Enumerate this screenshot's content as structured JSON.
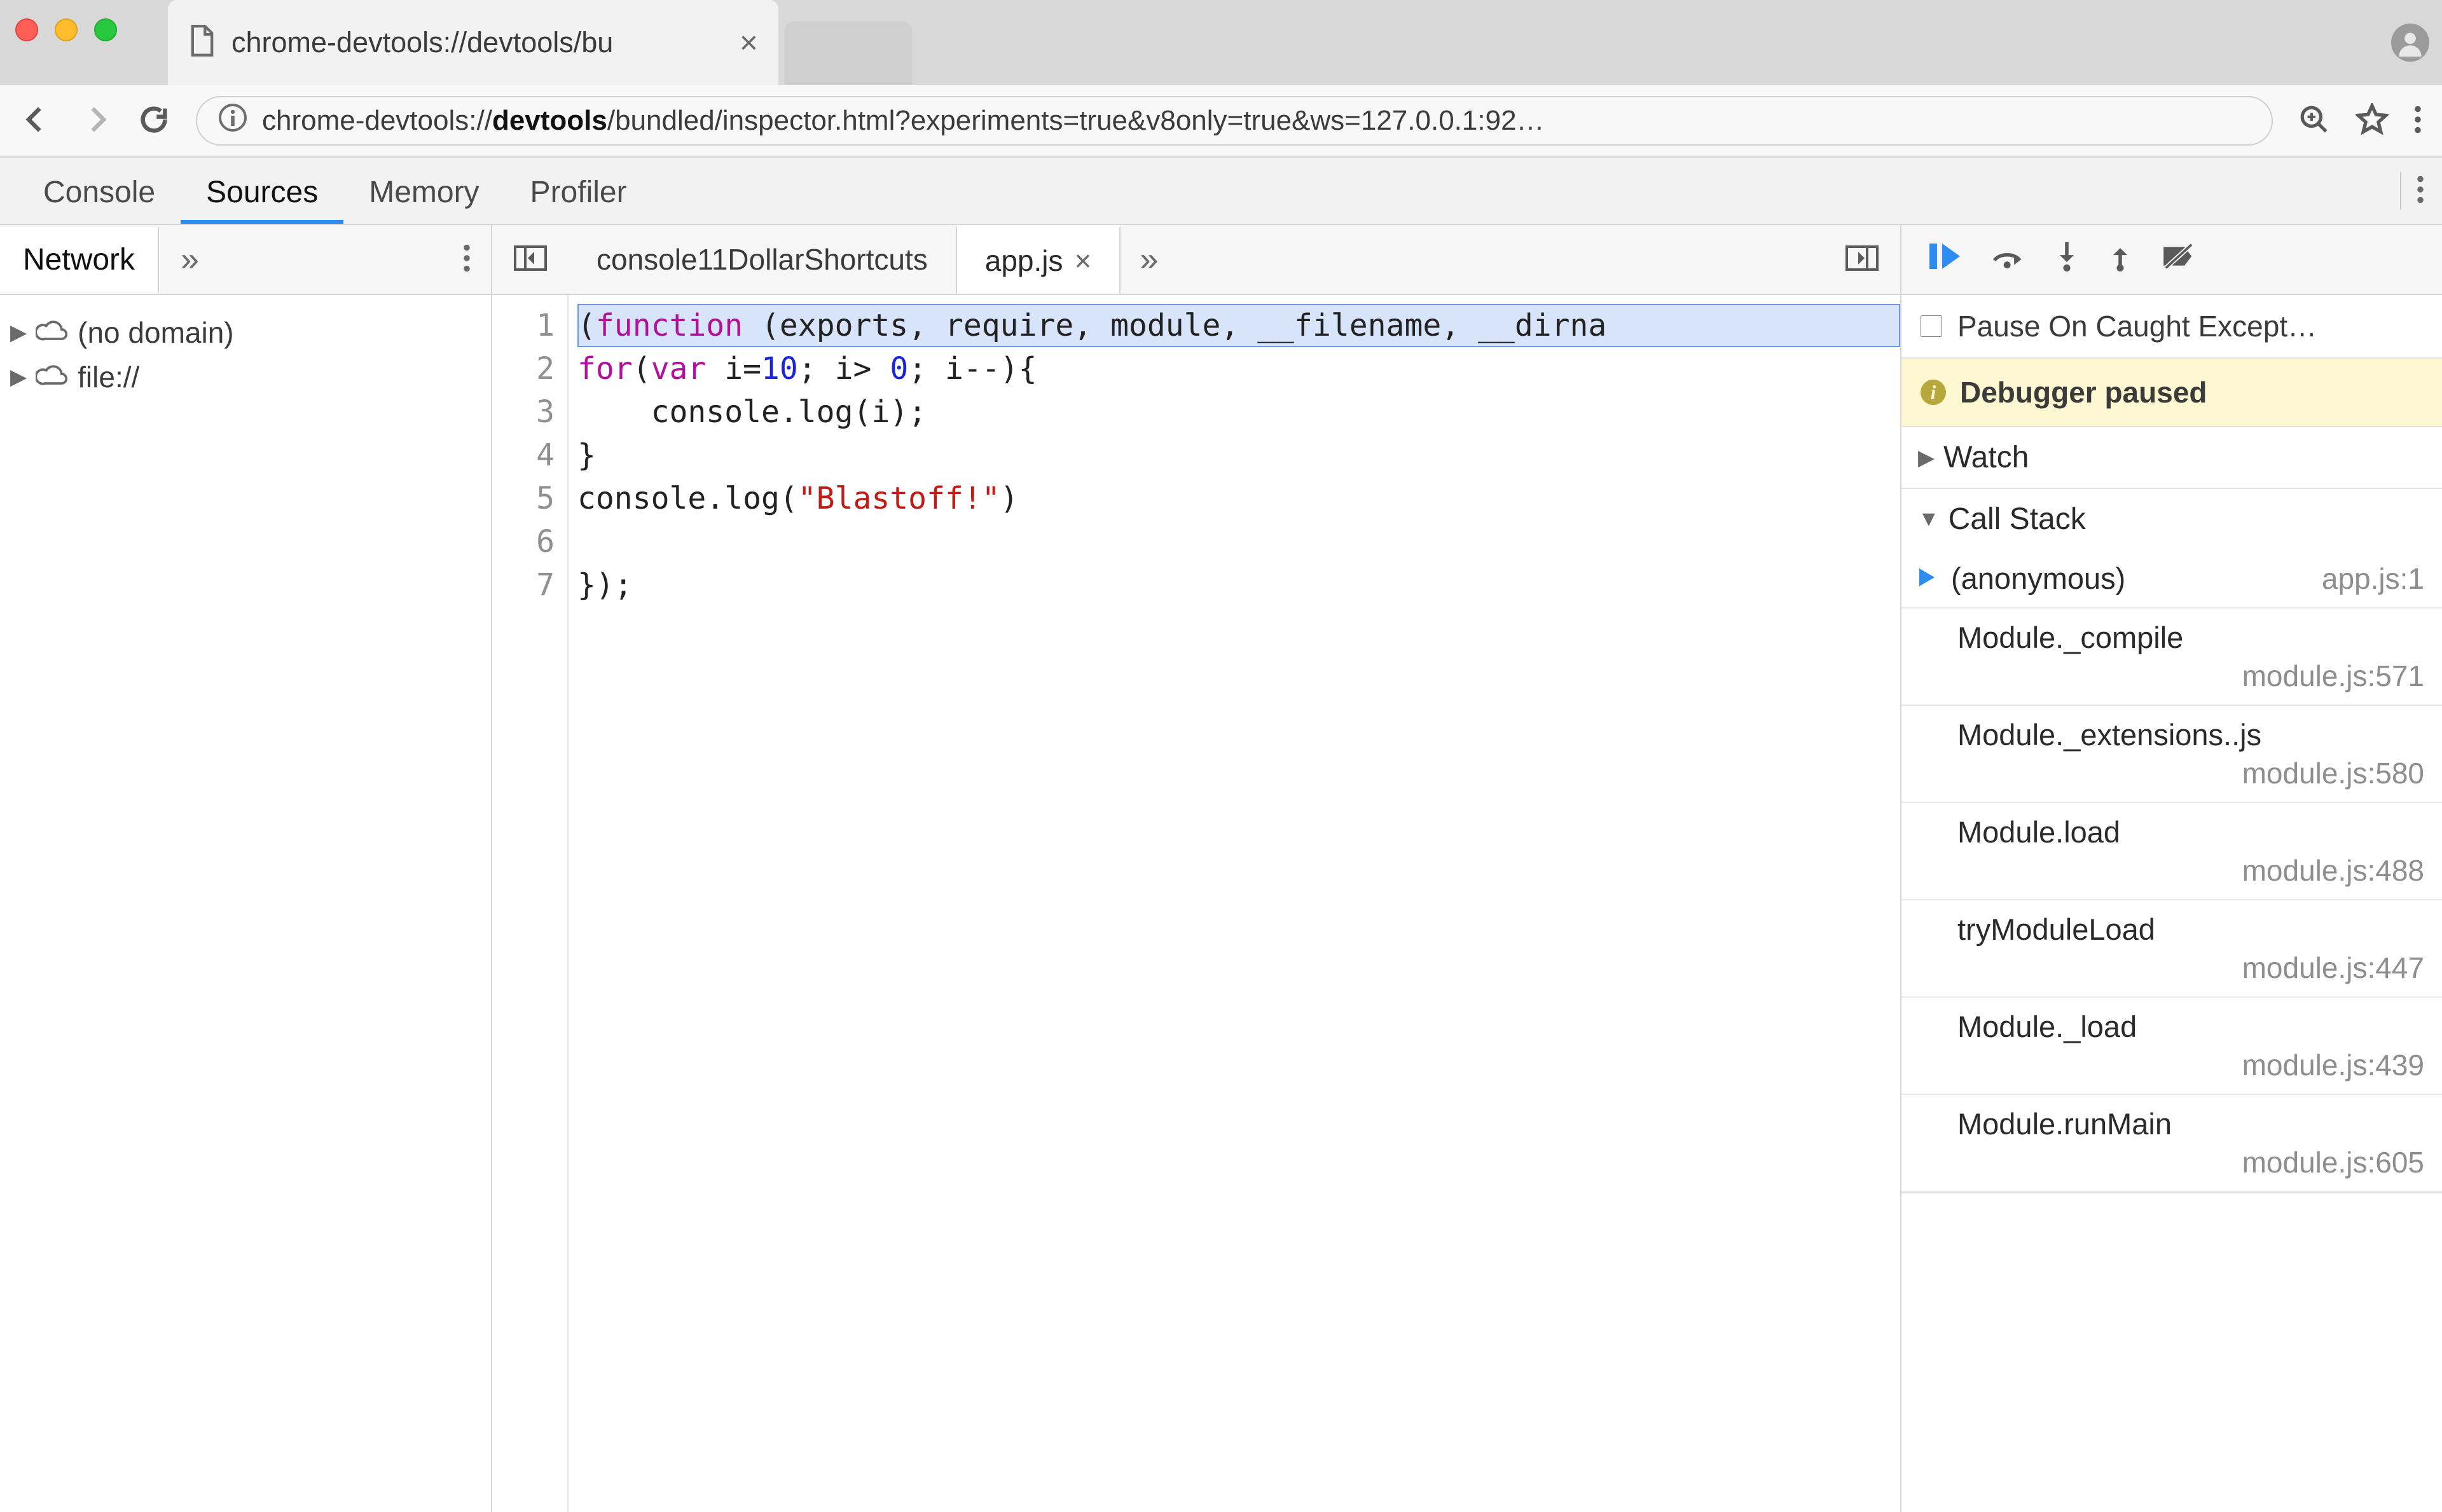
{
  "browser": {
    "tab_title": "chrome-devtools://devtools/bu",
    "url_plain_prefix": "chrome-devtools://",
    "url_bold": "devtools",
    "url_plain_suffix": "/bundled/inspector.html?experiments=true&v8only=true&ws=127.0.0.1:92…"
  },
  "devtools": {
    "tabs": [
      "Console",
      "Sources",
      "Memory",
      "Profiler"
    ],
    "active": "Sources"
  },
  "sidebar": {
    "tab": "Network",
    "nodes": [
      {
        "label": "(no domain)"
      },
      {
        "label": "file://"
      }
    ]
  },
  "editor": {
    "tabs": [
      {
        "label": "console11DollarShortcuts",
        "active": false
      },
      {
        "label": "app.js",
        "active": true
      }
    ],
    "gutter": [
      "1",
      "2",
      "3",
      "4",
      "5",
      "6",
      "7"
    ],
    "lines": [
      {
        "hl": true,
        "tokens": [
          [
            "(",
            "pln"
          ],
          [
            "function",
            "kw"
          ],
          [
            " (exports, require, module, __filename, __dirna",
            "pln"
          ]
        ]
      },
      {
        "hl": false,
        "tokens": [
          [
            "for",
            "kw"
          ],
          [
            "(",
            "pln"
          ],
          [
            "var",
            "kw"
          ],
          [
            " i=",
            "pln"
          ],
          [
            "10",
            "num"
          ],
          [
            "; i> ",
            "pln"
          ],
          [
            "0",
            "num"
          ],
          [
            "; i--){",
            "pln"
          ]
        ]
      },
      {
        "hl": false,
        "tokens": [
          [
            "    console.log(i);",
            "pln"
          ]
        ]
      },
      {
        "hl": false,
        "tokens": [
          [
            "}",
            "pln"
          ]
        ]
      },
      {
        "hl": false,
        "tokens": [
          [
            "console.log(",
            "pln"
          ],
          [
            "\"Blastoff!\"",
            "str"
          ],
          [
            ")",
            "pln"
          ]
        ]
      },
      {
        "hl": false,
        "tokens": [
          [
            "",
            "pln"
          ]
        ]
      },
      {
        "hl": false,
        "tokens": [
          [
            "});",
            "pln"
          ]
        ]
      }
    ]
  },
  "debugger": {
    "pause_on_caught_label": "Pause On Caught Except…",
    "status": "Debugger paused",
    "sections": {
      "watch": "Watch",
      "call_stack": "Call Stack"
    },
    "stack": [
      {
        "name": "(anonymous)",
        "loc": "app.js:1",
        "top": true
      },
      {
        "name": "Module._compile",
        "loc": "module.js:571",
        "top": false
      },
      {
        "name": "Module._extensions..js",
        "loc": "module.js:580",
        "top": false
      },
      {
        "name": "Module.load",
        "loc": "module.js:488",
        "top": false
      },
      {
        "name": "tryModuleLoad",
        "loc": "module.js:447",
        "top": false
      },
      {
        "name": "Module._load",
        "loc": "module.js:439",
        "top": false
      },
      {
        "name": "Module.runMain",
        "loc": "module.js:605",
        "top": false
      }
    ]
  }
}
